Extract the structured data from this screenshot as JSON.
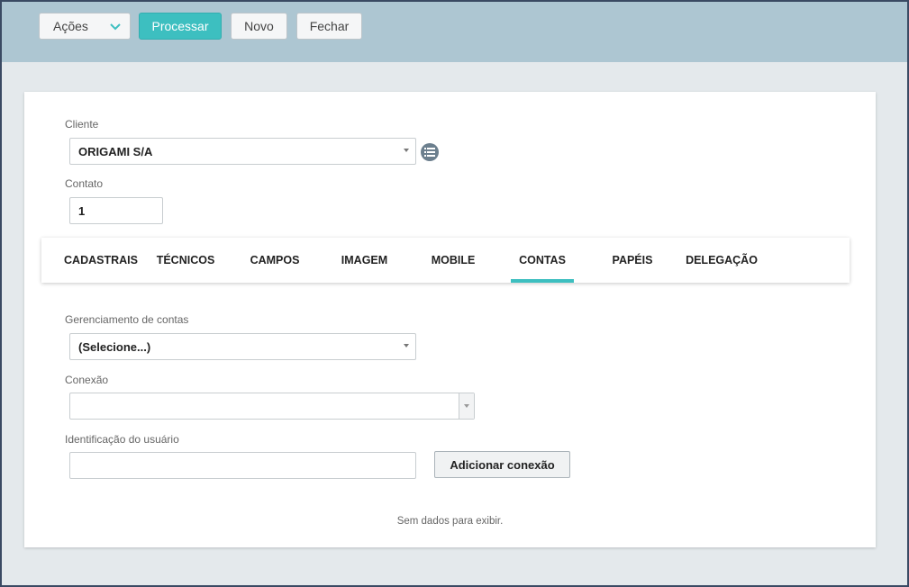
{
  "toolbar": {
    "acoes_label": "Ações",
    "processar_label": "Processar",
    "novo_label": "Novo",
    "fechar_label": "Fechar"
  },
  "form": {
    "cliente_label": "Cliente",
    "cliente_value": "ORIGAMI S/A",
    "contato_label": "Contato",
    "contato_value": "1"
  },
  "tabs": [
    {
      "label": "CADASTRAIS",
      "active": false
    },
    {
      "label": "TÉCNICOS",
      "active": false
    },
    {
      "label": "CAMPOS",
      "active": false
    },
    {
      "label": "IMAGEM",
      "active": false
    },
    {
      "label": "MOBILE",
      "active": false
    },
    {
      "label": "CONTAS",
      "active": true
    },
    {
      "label": "PAPÉIS",
      "active": false
    },
    {
      "label": "DELEGAÇÃO",
      "active": false
    }
  ],
  "contas": {
    "gerenciamento_label": "Gerenciamento de contas",
    "gerenciamento_value": "(Selecione...)",
    "conexao_label": "Conexão",
    "conexao_value": "",
    "identificacao_label": "Identificação do usuário",
    "identificacao_value": "",
    "add_button_label": "Adicionar conexão",
    "empty_message": "Sem dados para exibir."
  },
  "colors": {
    "accent": "#3dbfc0",
    "topbar": "#adc6d2",
    "background": "#e4e9ec"
  },
  "icons": [
    "chevron-down-icon",
    "list-icon",
    "dropdown-caret-icon"
  ]
}
